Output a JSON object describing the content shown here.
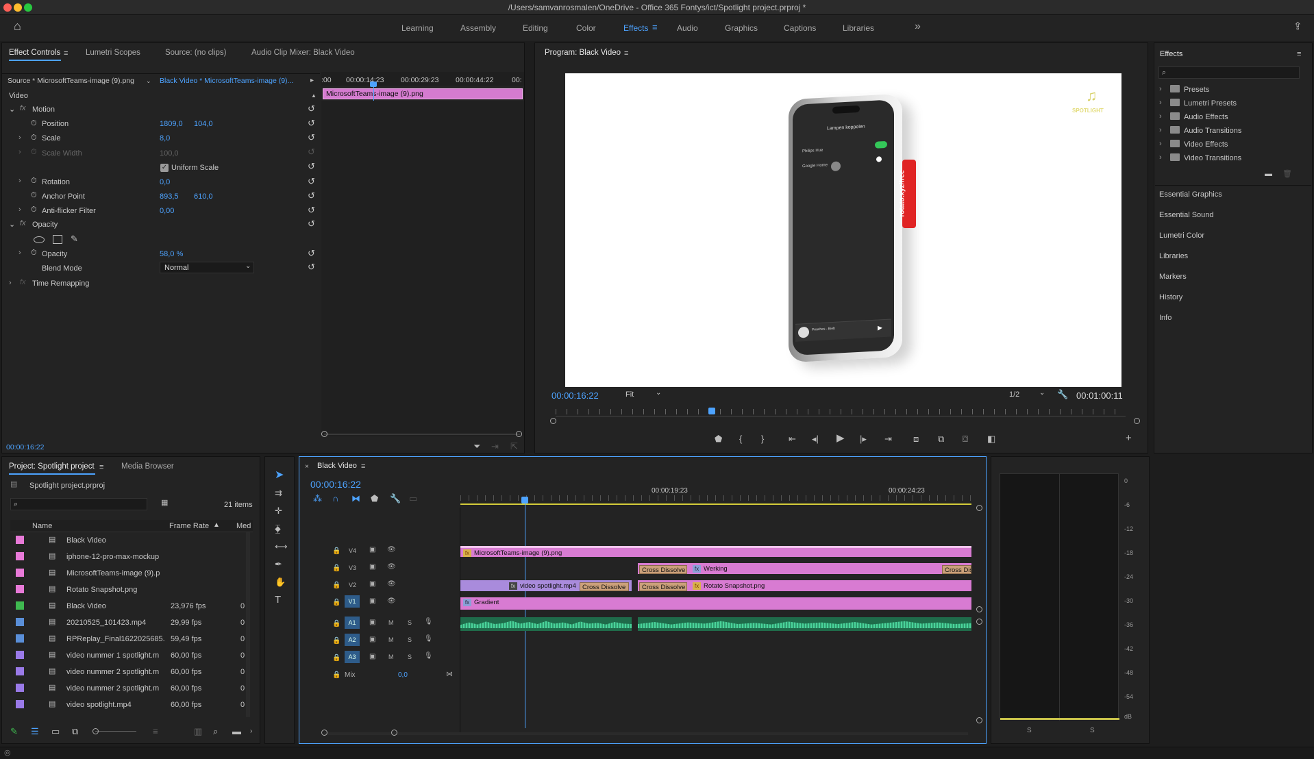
{
  "window": {
    "title": "/Users/samvanrosmalen/OneDrive - Office 365 Fontys/ict/Spotlight project.prproj *"
  },
  "workspaces": {
    "items": [
      "Learning",
      "Assembly",
      "Editing",
      "Color",
      "Effects",
      "Audio",
      "Graphics",
      "Captions",
      "Libraries"
    ],
    "active": "Effects",
    "more": "»"
  },
  "effect_controls": {
    "tabs": [
      "Effect Controls",
      "Lumetri Scopes",
      "Source: (no clips)",
      "Audio Clip Mixer: Black Video"
    ],
    "source_label": "Source * MicrosoftTeams-image (9).png",
    "sequence_label": "Black Video * MicrosoftTeams-image (9)...",
    "ruler": [
      ":00",
      "00:00:14:23",
      "00:00:29:23",
      "00:00:44:22",
      "00:"
    ],
    "clip_name": "MicrosoftTeams-image (9).png",
    "video_header": "Video",
    "motion": "Motion",
    "position_label": "Position",
    "position_x": "1809,0",
    "position_y": "104,0",
    "scale_label": "Scale",
    "scale_value": "8,0",
    "scale_width_label": "Scale Width",
    "scale_width_value": "100,0",
    "uniform_scale": "Uniform Scale",
    "rotation_label": "Rotation",
    "rotation_value": "0,0",
    "anchor_label": "Anchor Point",
    "anchor_x": "893,5",
    "anchor_y": "610,0",
    "antiflicker_label": "Anti-flicker Filter",
    "antiflicker_value": "0,00",
    "opacity_header": "Opacity",
    "opacity_label": "Opacity",
    "opacity_value": "58,0 %",
    "blend_label": "Blend Mode",
    "blend_value": "Normal",
    "time_remap": "Time Remapping",
    "timecode": "00:00:16:22"
  },
  "program": {
    "title": "Program: Black Video",
    "timecode": "00:00:16:22",
    "fit": "Fit",
    "resolution": "1/2",
    "duration": "00:01:00:11",
    "phone_header": "Lampen koppelen",
    "phone_row1": "Philips Hue",
    "phone_row2": "Google Home",
    "side_banner": "rotato.xyz/free",
    "logo_text": "SPOTLIGHT",
    "now_playing": "Peaches - Bieb"
  },
  "effects_panel": {
    "title": "Effects",
    "tree": [
      "Presets",
      "Lumetri Presets",
      "Audio Effects",
      "Audio Transitions",
      "Video Effects",
      "Video Transitions"
    ],
    "sections": [
      "Essential Graphics",
      "Essential Sound",
      "Lumetri Color",
      "Libraries",
      "Markers",
      "History",
      "Info"
    ]
  },
  "project": {
    "tabs": [
      "Project: Spotlight project",
      "Media Browser"
    ],
    "filename": "Spotlight project.prproj",
    "count": "21 items",
    "columns": [
      "Name",
      "Frame Rate",
      "Med"
    ],
    "rows": [
      {
        "name": "Black Video",
        "fps": "",
        "m": "",
        "color": "#e87ad8"
      },
      {
        "name": "iphone-12-pro-max-mockup",
        "fps": "",
        "m": "",
        "color": "#e87ad8"
      },
      {
        "name": "MicrosoftTeams-image (9).p",
        "fps": "",
        "m": "",
        "color": "#e87ad8"
      },
      {
        "name": "Rotato Snapshot.png",
        "fps": "",
        "m": "",
        "color": "#e87ad8"
      },
      {
        "name": "Black Video",
        "fps": "23,976 fps",
        "m": "0",
        "color": "#3fb950"
      },
      {
        "name": "20210525_101423.mp4",
        "fps": "29,99 fps",
        "m": "0",
        "color": "#5a8fd8"
      },
      {
        "name": "RPReplay_Final1622025685.",
        "fps": "59,49 fps",
        "m": "0",
        "color": "#5a8fd8"
      },
      {
        "name": "video nummer 1 spotlight.m",
        "fps": "60,00 fps",
        "m": "0",
        "color": "#9a7ae8"
      },
      {
        "name": "video nummer 2 spotlight.m",
        "fps": "60,00 fps",
        "m": "0",
        "color": "#9a7ae8"
      },
      {
        "name": "video nummer 2 spotlight.m",
        "fps": "60,00 fps",
        "m": "0",
        "color": "#9a7ae8"
      },
      {
        "name": "video spotlight.mp4",
        "fps": "60,00 fps",
        "m": "0",
        "color": "#9a7ae8"
      }
    ]
  },
  "timeline": {
    "tab": "Black Video",
    "timecode": "00:00:16:22",
    "ruler": [
      "00:00:19:23",
      "00:00:24:23"
    ],
    "tracks": [
      "V4",
      "V3",
      "V2",
      "V1",
      "A1",
      "A2",
      "A3"
    ],
    "mix_label": "Mix",
    "mix_value": "0,0",
    "clips": {
      "v4": "MicrosoftTeams-image (9).png",
      "v3_trans": "Cross Dissolve",
      "v3": "Werking",
      "v3_trans_end": "Cross Diss",
      "v2_video": "video spotlight.mp4",
      "v2_trans1": "Cross Dissolve",
      "v2_trans2": "Cross Dissolve",
      "v2_png": "Rotato Snapshot.png",
      "v1": "Gradient"
    }
  },
  "audio_meter": {
    "scale": [
      "0",
      "-6",
      "-12",
      "-18",
      "-24",
      "-30",
      "-36",
      "-42",
      "-48",
      "-54",
      "dB"
    ],
    "solo": [
      "S",
      "S"
    ]
  }
}
